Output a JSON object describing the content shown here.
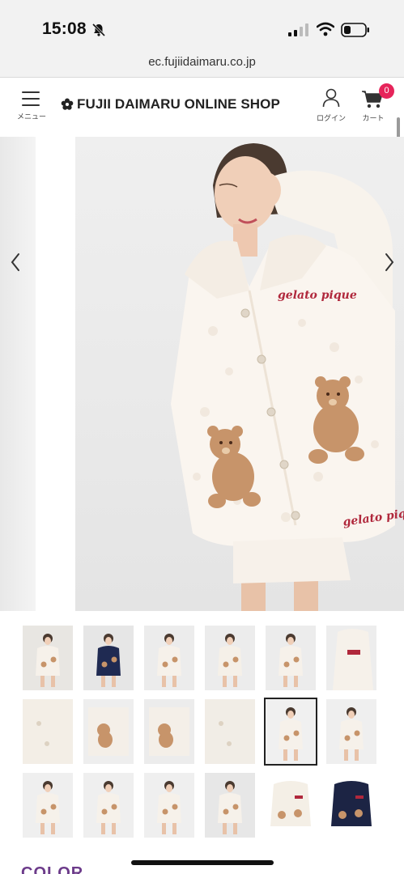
{
  "status_bar": {
    "time": "15:08",
    "icons": [
      "bell-slash-icon",
      "signal-icon",
      "wifi-icon",
      "battery-icon"
    ]
  },
  "browser": {
    "url": "ec.fujiidaimaru.co.jp"
  },
  "header": {
    "menu_label": "メニュー",
    "logo_text": "FUJII DAIMARU ONLINE SHOP",
    "login_label": "ログイン",
    "cart_label": "カート",
    "cart_count": "0",
    "colors": {
      "badge": "#e6245a",
      "accent": "#6c3b8a"
    }
  },
  "carousel": {
    "icons": [
      "chevron-left-icon",
      "chevron-right-icon"
    ],
    "embroidery_top": "gelato pique",
    "embroidery_hem": "gelato pique"
  },
  "thumbnails": {
    "count": 18,
    "selected_index": 10
  },
  "section": {
    "color_heading": "COLOR"
  }
}
